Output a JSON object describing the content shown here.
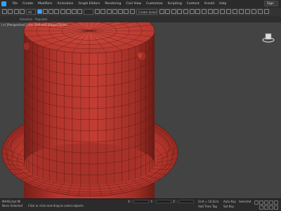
{
  "menubar": {
    "items": [
      "File",
      "Create",
      "Modifiers",
      "Animation",
      "Graph Editors",
      "Rendering",
      "Civil View",
      "Customize",
      "Scripting",
      "Content",
      "Arnold",
      "Help"
    ],
    "signin_label": "Sign in"
  },
  "toolbar": {
    "filter_value": "All",
    "selection_set_value": "Create Selection Se"
  },
  "subbar": {
    "tabs": [
      "Selection",
      "Populate"
    ]
  },
  "viewport": {
    "label": "[+] [Perspective] [User Defined] [Edged Faces]",
    "object_color": "#b3352c",
    "wire_color": "#5a1a14",
    "background_color": "#434343"
  },
  "statusbar": {
    "script_label": "MAXScript Mi",
    "selection_info": "None Selected",
    "prompt": "Click or click-and-drag to select objects",
    "coord_x": "X: -",
    "coord_y": "Y: -",
    "coord_z": "Z: -",
    "grid": "Grid = 10,0cm",
    "addtime": "Add Time Tag",
    "autokey": "Auto Key",
    "setkey": "Set Key",
    "selected": "Selected"
  }
}
